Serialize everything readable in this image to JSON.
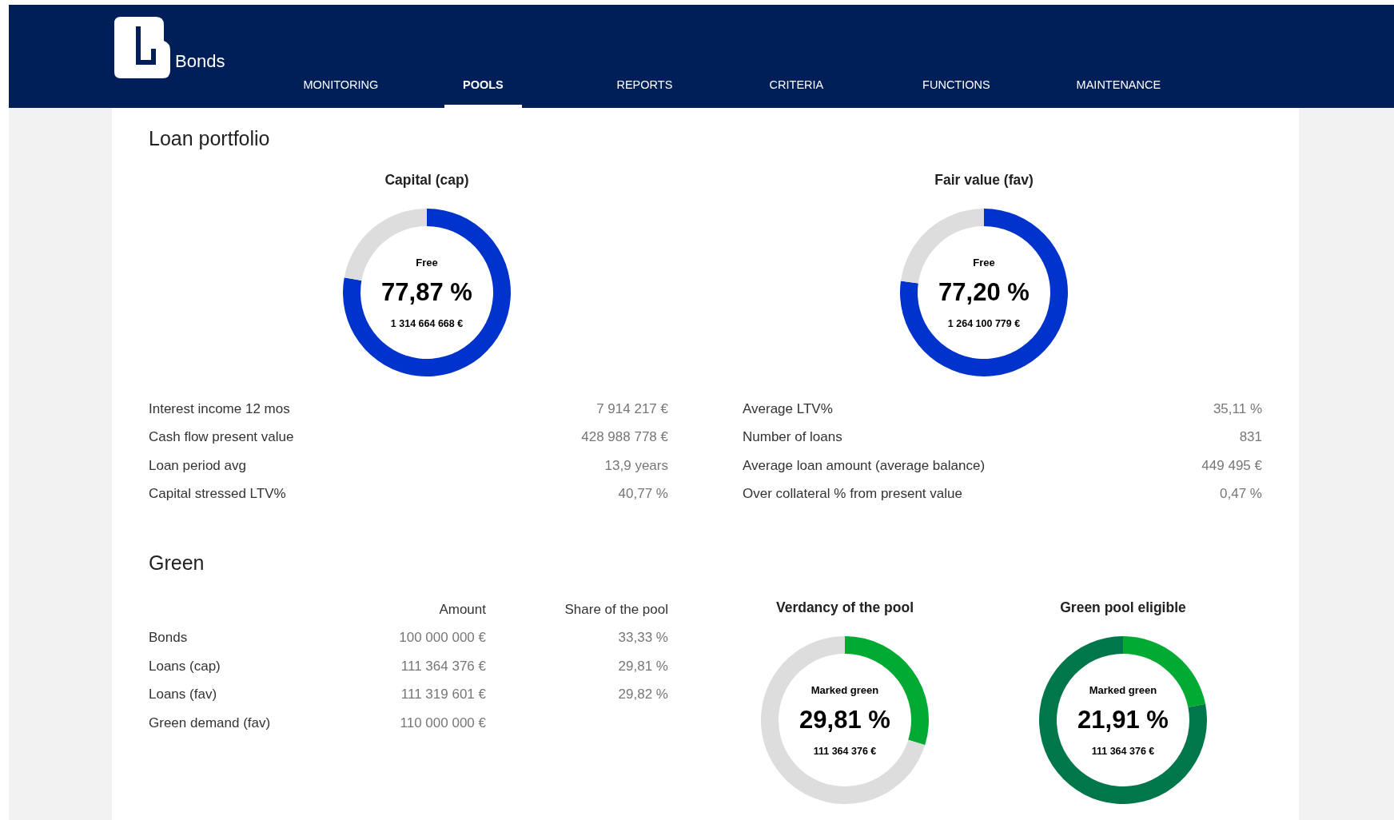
{
  "header": {
    "logo_text": "Bonds",
    "nav": [
      {
        "label": "MONITORING",
        "selected": false
      },
      {
        "label": "POOLS",
        "selected": true
      },
      {
        "label": "REPORTS",
        "selected": false
      },
      {
        "label": "CRITERIA",
        "selected": false
      },
      {
        "label": "FUNCTIONS",
        "selected": false
      },
      {
        "label": "MAINTENANCE",
        "selected": false
      }
    ]
  },
  "loan_portfolio": {
    "title": "Loan portfolio",
    "gauges": [
      {
        "title": "Capital (cap)",
        "caption": "Free",
        "percent": "77,87 %",
        "amount": "1 314 664 668 €",
        "chart_data": {
          "type": "donut",
          "series": [
            {
              "values": [
                77.87,
                22.13
              ]
            }
          ],
          "colors": [
            "#0033cc",
            "#dddddd"
          ]
        }
      },
      {
        "title": "Fair value (fav)",
        "caption": "Free",
        "percent": "77,20 %",
        "amount": "1 264 100 779 €",
        "chart_data": {
          "type": "donut",
          "series": [
            {
              "values": [
                77.2,
                22.8
              ]
            }
          ],
          "colors": [
            "#0033cc",
            "#dddddd"
          ]
        }
      }
    ],
    "stats_left": [
      {
        "label": "Interest income 12 mos",
        "value": "7 914 217 €"
      },
      {
        "label": "Cash flow present value",
        "value": "428 988 778 €"
      },
      {
        "label": "Loan period avg",
        "value": "13,9 years"
      },
      {
        "label": "Capital stressed LTV%",
        "value": "40,77 %"
      }
    ],
    "stats_right": [
      {
        "label": "Average LTV%",
        "value": "35,11 %"
      },
      {
        "label": "Number of loans",
        "value": "831"
      },
      {
        "label": "Average loan amount (average balance)",
        "value": "449 495 €"
      },
      {
        "label": "Over collateral % from present value",
        "value": "0,47 %"
      }
    ]
  },
  "green": {
    "title": "Green",
    "table": {
      "columns": [
        "Amount",
        "Share of the pool"
      ],
      "rows": [
        {
          "label": "Bonds",
          "amount": "100 000 000 €",
          "share": "33,33 %"
        },
        {
          "label": "Loans (cap)",
          "amount": "111 364 376 €",
          "share": "29,81 %"
        },
        {
          "label": "Loans (fav)",
          "amount": "111 319 601 €",
          "share": "29,82 %"
        },
        {
          "label": "Green demand (fav)",
          "amount": "110 000 000 €"
        }
      ]
    },
    "gauges": [
      {
        "title": "Verdancy of the pool",
        "caption": "Marked green",
        "percent": "29,81 %",
        "amount": "111 364 376 €",
        "chart_data": {
          "type": "donut",
          "series": [
            {
              "values": [
                29.81,
                70.19
              ]
            }
          ],
          "colors": [
            "#00aa33",
            "#dddddd"
          ]
        }
      },
      {
        "title": "Green pool eligible",
        "caption": "Marked green",
        "percent": "21,91 %",
        "amount": "111 364 376 €",
        "chart_data": {
          "type": "donut",
          "series": [
            {
              "values": [
                21.91,
                78.09
              ]
            }
          ],
          "colors": [
            "#00aa33",
            "#00774a"
          ]
        }
      }
    ]
  }
}
